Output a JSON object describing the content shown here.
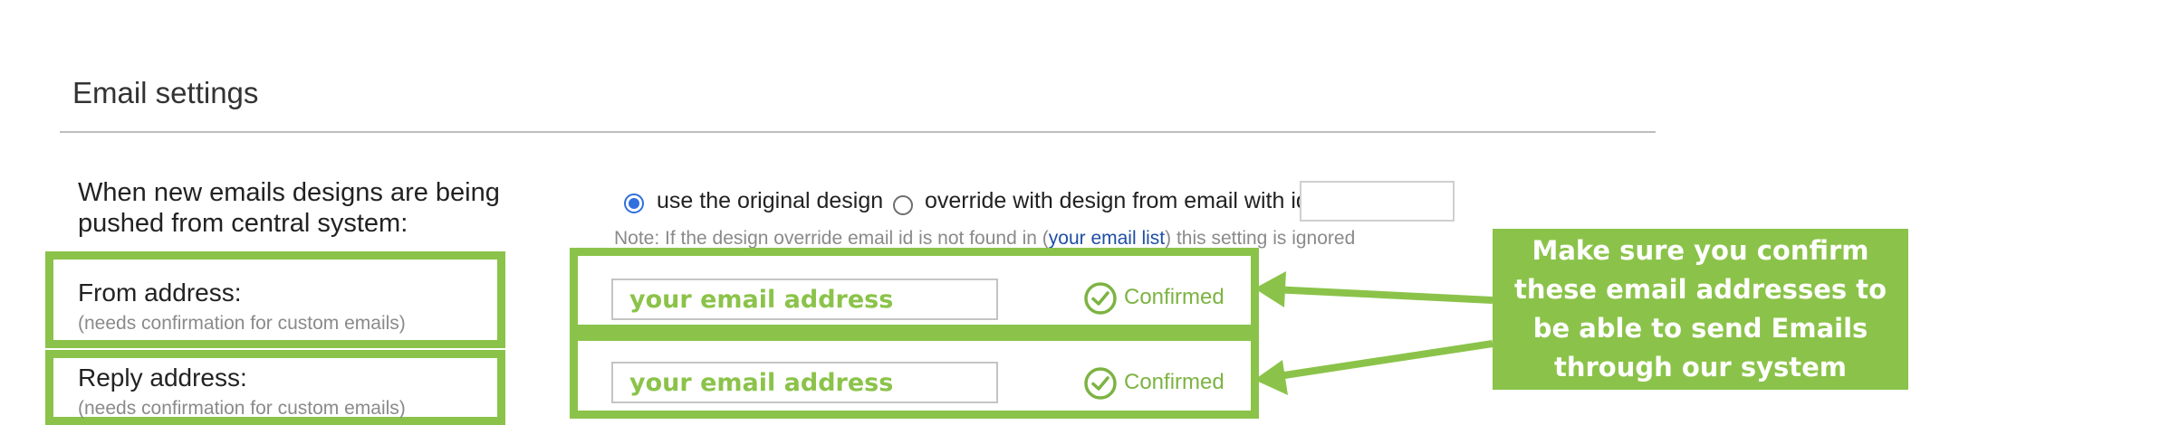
{
  "section": {
    "title": "Email settings"
  },
  "design_setting": {
    "label": "When new emails designs are being pushed from central system:",
    "options": [
      {
        "label": "use the original design",
        "selected": true
      },
      {
        "label": "override with design from email with id",
        "selected": false
      }
    ],
    "override_id_value": "",
    "note_prefix": "Note: If the design override email id is not found in (",
    "note_link": "your email list",
    "note_suffix": ") this setting is ignored"
  },
  "from_address": {
    "label": "From address:",
    "hint": "(needs confirmation for custom emails)",
    "value": "your email address",
    "status": "Confirmed"
  },
  "reply_address": {
    "label": "Reply address:",
    "hint": "(needs confirmation for custom emails)",
    "value": "your email address",
    "status": "Confirmed"
  },
  "callout": {
    "text": "Make sure you confirm these email addresses to be able to send Emails through our system"
  },
  "colors": {
    "highlight": "#8bc34a",
    "radio_selected": "#2f6fe0",
    "link": "#1f4ea3",
    "confirmed": "#7cb342"
  },
  "icons": [
    "check-circle-icon",
    "arrow-icon"
  ]
}
